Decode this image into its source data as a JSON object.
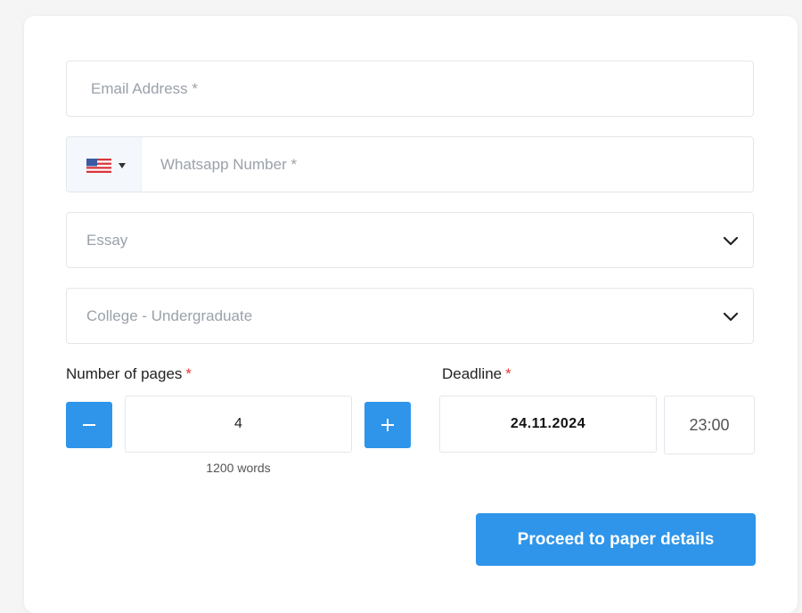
{
  "form": {
    "email": {
      "placeholder": "Email Address *"
    },
    "whatsapp": {
      "placeholder": "Whatsapp Number *",
      "country_flag": "us-flag-icon"
    },
    "paper_type": {
      "selected": "Essay"
    },
    "academic_level": {
      "selected": "College - Undergraduate"
    },
    "pages": {
      "label": "Number of pages",
      "required_mark": "*",
      "value": "4",
      "words": "1200 words"
    },
    "deadline": {
      "label": "Deadline",
      "required_mark": "*",
      "date": "24.11.2024",
      "time": "23:00"
    },
    "submit_label": "Proceed to paper details"
  },
  "colors": {
    "accent": "#2e95ea",
    "required": "#e53935",
    "placeholder": "#9aa1aa",
    "border": "#e3e6ea"
  }
}
